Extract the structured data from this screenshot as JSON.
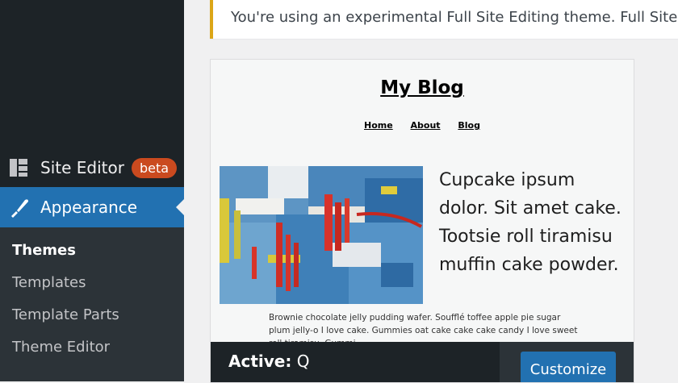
{
  "sidebar": {
    "site_editor_label": "Site Editor",
    "site_editor_badge": "beta",
    "appearance_label": "Appearance",
    "submenu": [
      "Themes",
      "Templates",
      "Template Parts",
      "Theme Editor"
    ]
  },
  "notice": {
    "text": "You're using an experimental Full Site Editing theme. Full Site Editing"
  },
  "preview": {
    "blog_title": "My Blog",
    "nav": [
      "Home",
      "About",
      "Blog"
    ],
    "hero_text": "Cupcake ipsum dolor. Sit amet cake. Tootsie roll tiramisu muffin cake powder.",
    "body_text": "Brownie chocolate jelly pudding wafer. Soufflé toffee apple pie sugar plum jelly-o I love cake. Gummies oat cake cake cake candy I love sweet roll tiramisu. Gummi"
  },
  "active_bar": {
    "label": "Active:",
    "theme_name": "Q",
    "customize_label": "Customize"
  },
  "colors": {
    "sidebar_bg": "#1d2327",
    "submenu_bg": "#2c3338",
    "accent": "#2271b1",
    "beta_badge": "#ca4a1f",
    "notice_border": "#dba617"
  }
}
